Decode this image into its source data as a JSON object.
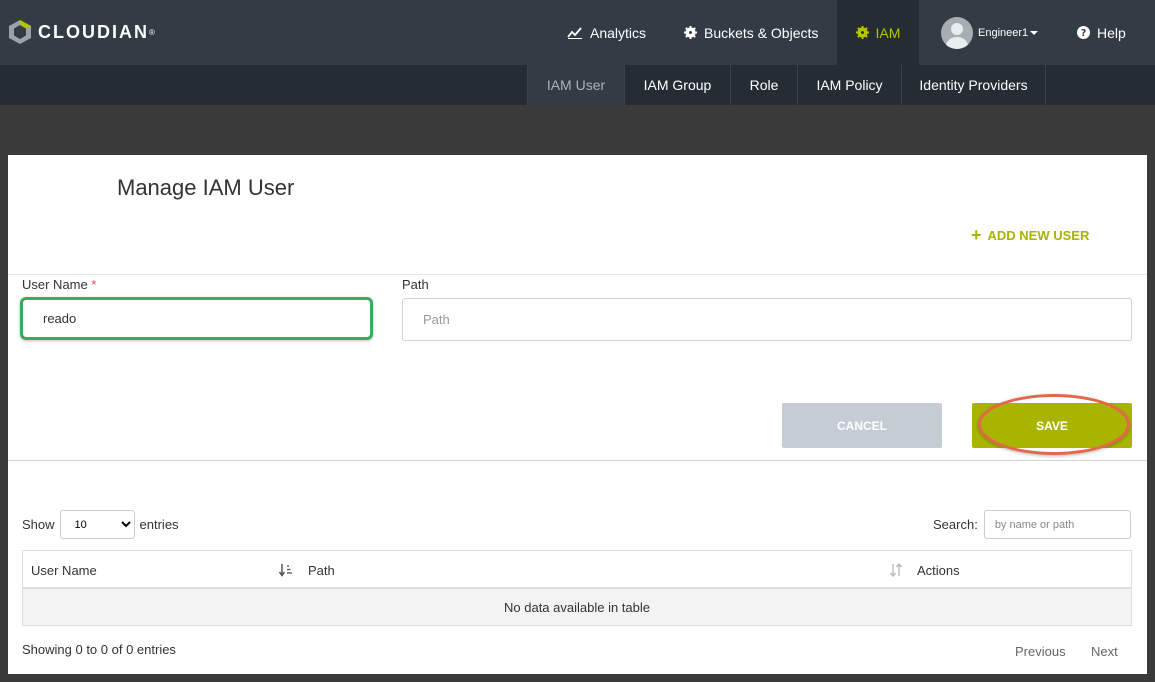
{
  "brand": {
    "name": "CLOUDIAN",
    "mark": "®"
  },
  "nav": {
    "analytics": "Analytics",
    "buckets": "Buckets & Objects",
    "iam": "IAM",
    "user": "Engineer1",
    "help": "Help"
  },
  "subnav": [
    "IAM User",
    "IAM Group",
    "Role",
    "IAM Policy",
    "Identity Providers"
  ],
  "page": {
    "title": "Manage IAM User",
    "add_user": "ADD NEW USER"
  },
  "form": {
    "user_label": "User Name",
    "required_mark": "*",
    "user_value": "reado",
    "path_label": "Path",
    "path_placeholder": "Path",
    "cancel": "CANCEL",
    "save": "SAVE"
  },
  "list": {
    "show_label": "Show",
    "page_size": "10",
    "entries_label": "entries",
    "search_label": "Search:",
    "search_placeholder": "by name or path",
    "columns": [
      "User Name",
      "Path",
      "Actions"
    ],
    "empty": "No data available in table",
    "info": "Showing 0 to 0 of 0 entries",
    "prev": "Previous",
    "next": "Next"
  },
  "colors": {
    "accent": "#a8b400",
    "header": "#333b44",
    "highlight_green": "#3aaa5c",
    "highlight_red": "#e4674a"
  }
}
